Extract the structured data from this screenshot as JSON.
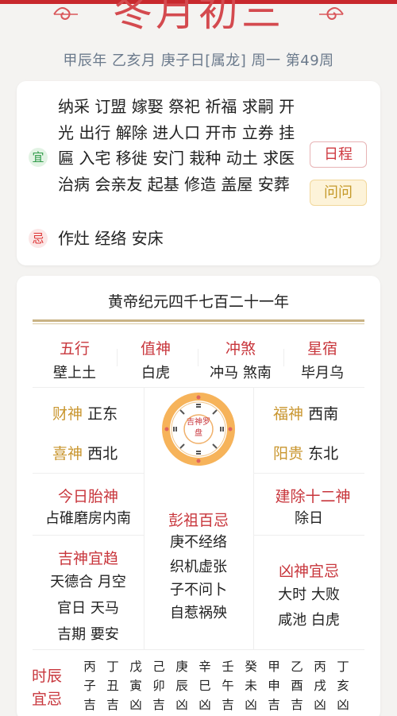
{
  "header": {
    "title": "冬月初三",
    "subtitle": "甲辰年 乙亥月 庚子日[属龙] 周一 第49周"
  },
  "yi_ji": {
    "yi_badge": "宜",
    "yi_text": "纳采 订盟 嫁娶 祭祀 祈福 求嗣 开光 出行 解除 进人口 开市 立券 挂匾 入宅 移徙 安门 栽种 动土 求医 治病 会亲友 起基 修造 盖屋 安葬",
    "ji_badge": "忌",
    "ji_text": "作灶 经络 安床",
    "btn_schedule": "日程",
    "btn_ask": "问问"
  },
  "almanac": {
    "era": "黄帝纪元四千七百二十一年",
    "categories": [
      {
        "h": "五行",
        "v": "壁上土"
      },
      {
        "h": "值神",
        "v": "白虎"
      },
      {
        "h": "冲煞",
        "v": "冲马 煞南"
      },
      {
        "h": "星宿",
        "v": "毕月乌"
      }
    ],
    "caishen_k": "财神",
    "caishen_v": "正东",
    "xishen_k": "喜神",
    "xishen_v": "西北",
    "fushen_k": "福神",
    "fushen_v": "西南",
    "yanggui_k": "阳贵",
    "yanggui_v": "东北",
    "compass_center": "吉神罗盘",
    "taishen_h": "今日胎神",
    "taishen_v": "占碓磨房内南",
    "jianchu_h": "建除十二神",
    "jianchu_v": "除日",
    "pengzu_h": "彭祖百忌",
    "pengzu_v1": "庚不经络",
    "pengzu_v2": "织机虚张",
    "pengzu_v3": "子不问卜",
    "pengzu_v4": "自惹祸殃",
    "jishen_h": "吉神宜趋",
    "jishen_v1": "天德合 月空",
    "jishen_v2": "官日 天马",
    "jishen_v3": "吉期 要安",
    "xiongshen_h": "凶神宜忌",
    "xiongshen_v1": "大时 大败",
    "xiongshen_v2": "咸池 白虎",
    "shichen_label": "时辰宜忌",
    "shichen": [
      {
        "g": "丙",
        "z": "子",
        "l": "吉"
      },
      {
        "g": "丁",
        "z": "丑",
        "l": "吉"
      },
      {
        "g": "戊",
        "z": "寅",
        "l": "凶"
      },
      {
        "g": "己",
        "z": "卯",
        "l": "吉"
      },
      {
        "g": "庚",
        "z": "辰",
        "l": "凶"
      },
      {
        "g": "辛",
        "z": "巳",
        "l": "凶"
      },
      {
        "g": "壬",
        "z": "午",
        "l": "吉"
      },
      {
        "g": "癸",
        "z": "未",
        "l": "凶"
      },
      {
        "g": "甲",
        "z": "申",
        "l": "吉"
      },
      {
        "g": "乙",
        "z": "酉",
        "l": "吉"
      },
      {
        "g": "丙",
        "z": "戌",
        "l": "凶"
      },
      {
        "g": "丁",
        "z": "亥",
        "l": "凶"
      }
    ]
  },
  "colors": {
    "accent": "#c8363c",
    "gold": "#c9962f",
    "green": "#2f9a48",
    "bg": "#f4f3f1"
  }
}
